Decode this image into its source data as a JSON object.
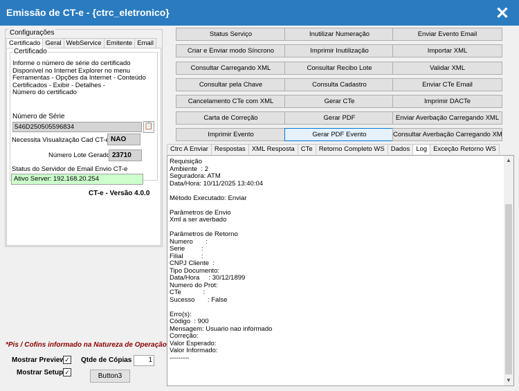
{
  "window": {
    "title": "Emissão de CT-e  - {ctrc_eletronico}",
    "close_glyph": "✕"
  },
  "config": {
    "legend": "Configurações",
    "tabs": [
      "Certificado",
      "Geral",
      "WebService",
      "Emitente",
      "Email"
    ],
    "active_tab": "Certificado",
    "certificado_legend": "Certificado",
    "cert_info": "Informe o número de série do certificado\nDisponível no Internet Explorer no menu\nFerramentas - Opções da Internet - Conteúdo\nCertificados - Exibir - Detalhes -\nNúmero do certificado",
    "serie_label": "Número de Série",
    "serie_value": "546D250505596834",
    "visualizacao_label": "Necessita Visualização Cad CT-e",
    "visualizacao_value": "NAO",
    "lote_label": "Número Lote Gerado",
    "lote_value": "23710",
    "status_label": "Status do Servidor de Email Envio CT-e",
    "status_value": "Ativo Server: 192.168.20.254",
    "version": "CT-e - Versão 4.0.0"
  },
  "bottom": {
    "pis_note": "*Pis / Cofins informado na Natureza de Operação.",
    "preview_label": "Mostrar Preview",
    "preview_checked": true,
    "setup_label": "Mostrar Setup",
    "setup_checked": true,
    "copies_label": "Qtde de Cópias",
    "copies_value": "1",
    "button3": "Button3",
    "check_glyph": "✓"
  },
  "actions": [
    "Status Serviço",
    "Inutilizar Numeração",
    "Enviar Evento Email",
    "Criar e Enviar modo Síncrono",
    "Imprimir Inutilização",
    "Importar XML",
    "Consultar Carregando XML",
    "Consultar Recibo Lote",
    "Validar XML",
    "Consultar pela Chave",
    "Consulta Cadastro",
    "Enviar CTe Email",
    "Cancelamento CTe com XML",
    "Gerar CTe",
    "Imprimir DACTe",
    "Carta de Correção",
    "Gerar PDF",
    "Enviar Averbação Carregando XML",
    "Imprimir Evento",
    "Gerar PDF Evento",
    "Consultar Averbação Carregando XML"
  ],
  "result_tabs": [
    "Ctrc A Enviar",
    "Respostas",
    "XML Resposta",
    "CTe",
    "Retorno Completo WS",
    "Dados",
    "Log",
    "Exceção Retorno WS"
  ],
  "active_result_tab": "Log",
  "log_text": "Requisição\nAmbiente  : 2\nSeguradora: ATM\nData/Hora: 10/11/2025 13:40:04\n\nMétodo Executado: Enviar\n\nParâmetros de Envio\nXml a ser averbado\n\nParâmetros de Retorno\nNumero       :\nSerie         :\nFilial          :\nCNPJ Cliente  :\nTipo Documento:\nData/Hora     : 30/12/1899\nNumero do Prot:\nCTe            :\nSucesso       : False\n\nErro(s):\nCódigo  : 900\nMensagem: Usuario nao informado\nCorreção:\nValor Esperado:\nValor Informado:\n---------",
  "scroll": {
    "up": "▲",
    "down": "▼"
  },
  "icons": {
    "serie_button": "📋"
  }
}
